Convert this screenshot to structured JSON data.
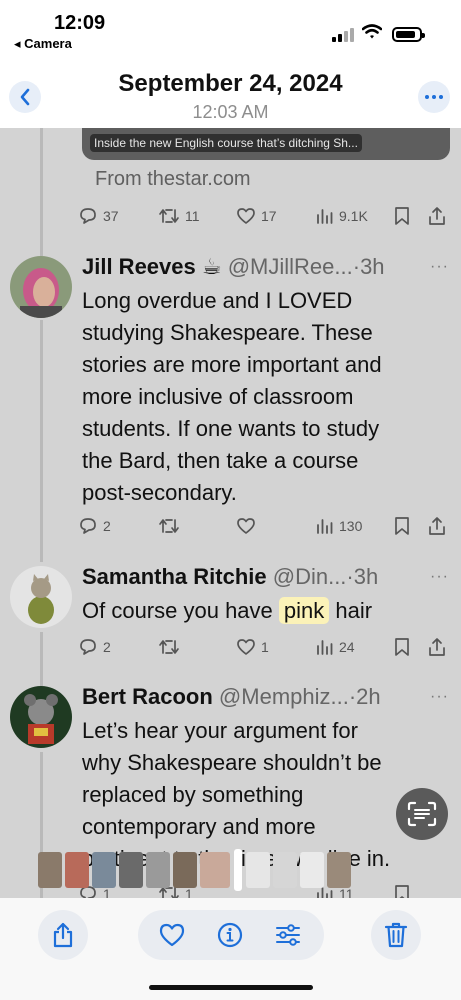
{
  "status_bar": {
    "time": "12:09",
    "back_app": "◂ Camera"
  },
  "header": {
    "date": "September 24, 2024",
    "time": "12:03 AM"
  },
  "link_card": {
    "caption": "Inside the new English course that’s ditching Sh...",
    "source": "From thestar.com"
  },
  "first_actions": {
    "replies": "37",
    "reposts": "11",
    "likes": "17",
    "views": "9.1K"
  },
  "tweets": [
    {
      "name": "Jill Reeves ☕",
      "handle": "@MJillRee...",
      "time": "·3h",
      "more": "···",
      "lines": [
        "Long overdue and I LOVED",
        "studying Shakespeare.  These",
        "stories are more important and",
        "more inclusive of classroom",
        "students.  If one wants to study",
        "the Bard, then take a course",
        "post-secondary."
      ],
      "replies": "2",
      "reposts": "",
      "likes": "",
      "views": "130"
    },
    {
      "name": "Samantha Ritchie",
      "handle": "@Din...",
      "time": "·3h",
      "more": "···",
      "text_before": "Of course you have ",
      "text_highlight": "pink",
      "text_after": " hair",
      "replies": "2",
      "reposts": "",
      "likes": "1",
      "views": "24"
    },
    {
      "name": "Bert Racoon",
      "handle": "@Memphiz...",
      "time": "·2h",
      "more": "···",
      "lines": [
        "Let’s hear your argument for",
        "why Shakespeare shouldn’t be",
        "replaced by something",
        "contemporary and more",
        "pertinent to the times we live in."
      ],
      "replies": "1",
      "reposts": "1",
      "views": "11"
    }
  ],
  "colors": {
    "dim_background": "#d3d3d3",
    "highlight": "#fbf2b8",
    "accent": "#1e6fd9",
    "delete": "#1e6fd9"
  },
  "toolbar": {
    "share_icon": "share-icon",
    "favorite_icon": "heart-icon",
    "info_icon": "info-icon",
    "adjust_icon": "sliders-icon",
    "delete_icon": "trash-icon"
  }
}
